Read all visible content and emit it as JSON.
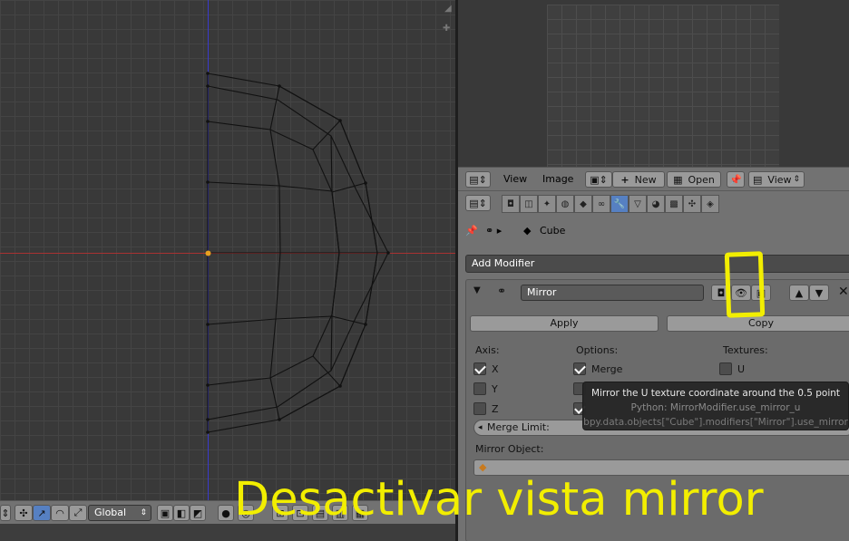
{
  "viewport": {
    "transform_orientation": "Global"
  },
  "image_editor": {
    "menu_view": "View",
    "menu_image": "Image",
    "new_label": "New",
    "open_label": "Open",
    "view_select": "View"
  },
  "properties": {
    "breadcrumb_object": "Cube",
    "add_modifier_label": "Add Modifier",
    "modifier": {
      "name": "Mirror",
      "apply_label": "Apply",
      "copy_label": "Copy",
      "axis_heading": "Axis:",
      "options_heading": "Options:",
      "textures_heading": "Textures:",
      "axis_x": {
        "label": "X",
        "checked": true
      },
      "axis_y": {
        "label": "Y",
        "checked": false
      },
      "axis_z": {
        "label": "Z",
        "checked": false
      },
      "merge": {
        "label": "Merge",
        "checked": true
      },
      "texture_u": {
        "label": "U",
        "checked": false
      },
      "merge_limit_label": "Merge Limit:",
      "mirror_object_label": "Mirror Object:"
    }
  },
  "tooltip": {
    "line1": "Mirror the U texture coordinate around the 0.5 point",
    "line2": "Python: MirrorModifier.use_mirror_u",
    "line3": "bpy.data.objects[\"Cube\"].modifiers[\"Mirror\"].use_mirror"
  },
  "annotation": {
    "caption": "Desactivar  vista  mirror",
    "color": "#f2ee00"
  },
  "colors": {
    "active_tab": "#5680c2",
    "panel_bg": "#727272"
  }
}
